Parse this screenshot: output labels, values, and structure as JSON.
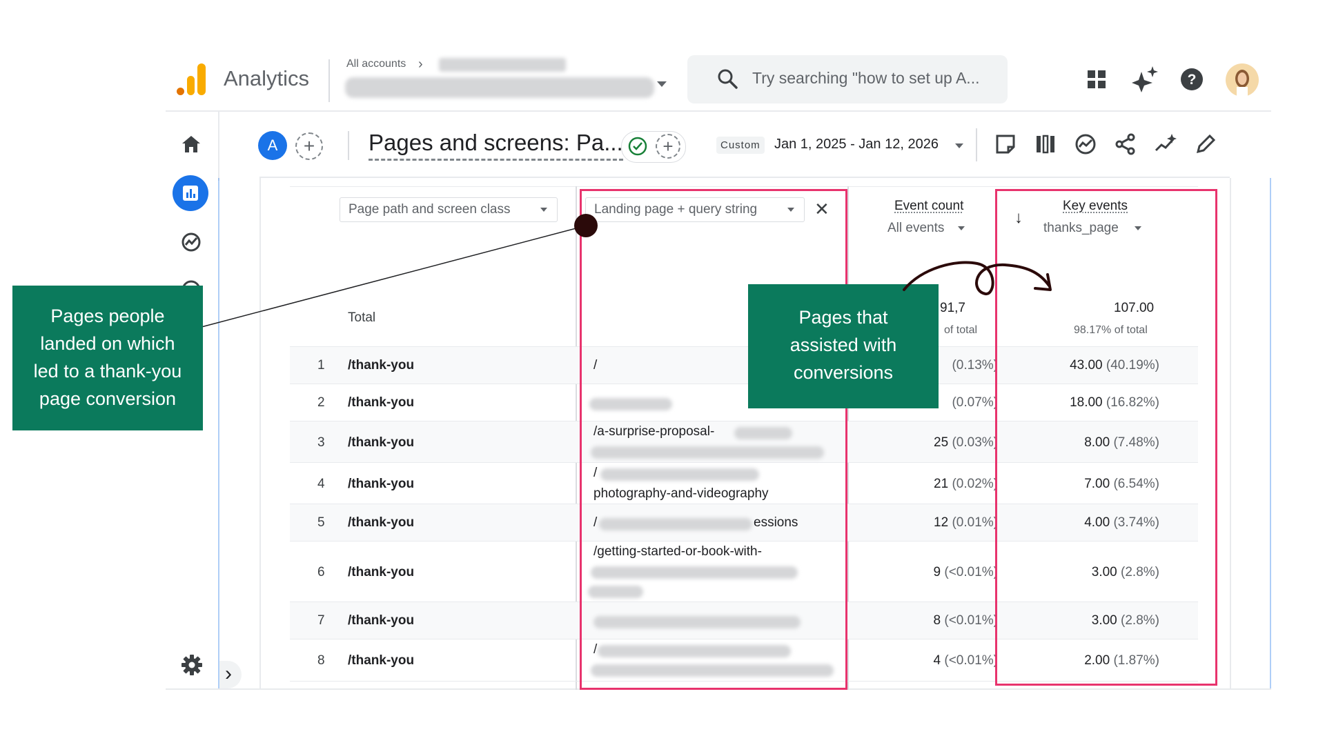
{
  "topbar": {
    "app_name": "Analytics",
    "accounts_label": "All accounts",
    "search_placeholder": "Try searching \"how to set up A..."
  },
  "report": {
    "avatar_letter": "A",
    "title": "Pages and screens: Pa...",
    "date_chip": "Custom",
    "date_range": "Jan 1, 2025 - Jan 12, 2026"
  },
  "table": {
    "dim1": "Page path and screen class",
    "dim2": "Landing page + query string",
    "metric1": {
      "label": "Event count",
      "sub": "All events"
    },
    "metric2": {
      "label": "Key events",
      "sub": "thanks_page"
    },
    "total": {
      "label": "Total",
      "event_value": "91,7",
      "event_pct": "of total",
      "key_value": "107.00",
      "key_pct": "98.17% of total"
    },
    "rows": [
      {
        "n": "1",
        "page": "/thank-you",
        "lp1": "/",
        "lp2": "",
        "ev": "",
        "ev_pct": "(0.13%)",
        "ke": "43.00",
        "ke_pct": "(40.19%)"
      },
      {
        "n": "2",
        "page": "/thank-you",
        "lp1": "",
        "lp2": "",
        "ev": "",
        "ev_pct": "(0.07%)",
        "ke": "18.00",
        "ke_pct": "(16.82%)"
      },
      {
        "n": "3",
        "page": "/thank-you",
        "lp1": "/a-surprise-proposal-",
        "lp2": "",
        "ev": "25",
        "ev_pct": "(0.03%)",
        "ke": "8.00",
        "ke_pct": "(7.48%)"
      },
      {
        "n": "4",
        "page": "/thank-you",
        "lp1": "/",
        "lp2": "photography-and-videography",
        "ev": "21",
        "ev_pct": "(0.02%)",
        "ke": "7.00",
        "ke_pct": "(6.54%)"
      },
      {
        "n": "5",
        "page": "/thank-you",
        "lp1": "/",
        "lp2": "essions",
        "ev": "12",
        "ev_pct": "(0.01%)",
        "ke": "4.00",
        "ke_pct": "(3.74%)"
      },
      {
        "n": "6",
        "page": "/thank-you",
        "lp1": "/getting-started-or-book-with-",
        "lp2": "",
        "ev": "9",
        "ev_pct": "(<0.01%)",
        "ke": "3.00",
        "ke_pct": "(2.8%)"
      },
      {
        "n": "7",
        "page": "/thank-you",
        "lp1": "",
        "lp2": "",
        "ev": "8",
        "ev_pct": "(<0.01%)",
        "ke": "3.00",
        "ke_pct": "(2.8%)"
      },
      {
        "n": "8",
        "page": "/thank-you",
        "lp1": "/",
        "lp2": "",
        "ev": "4",
        "ev_pct": "(<0.01%)",
        "ke": "2.00",
        "ke_pct": "(1.87%)"
      }
    ]
  },
  "annotations": {
    "left": "Pages people landed on which led to a thank-you page conversion",
    "middle": "Pages that assisted with conversions"
  },
  "colors": {
    "annotation_green": "#0b7a5c",
    "highlight_pink": "#e8336d",
    "accent_blue": "#1a73e8",
    "logo_orange": "#f9ab00",
    "logo_dark_orange": "#e37400"
  }
}
